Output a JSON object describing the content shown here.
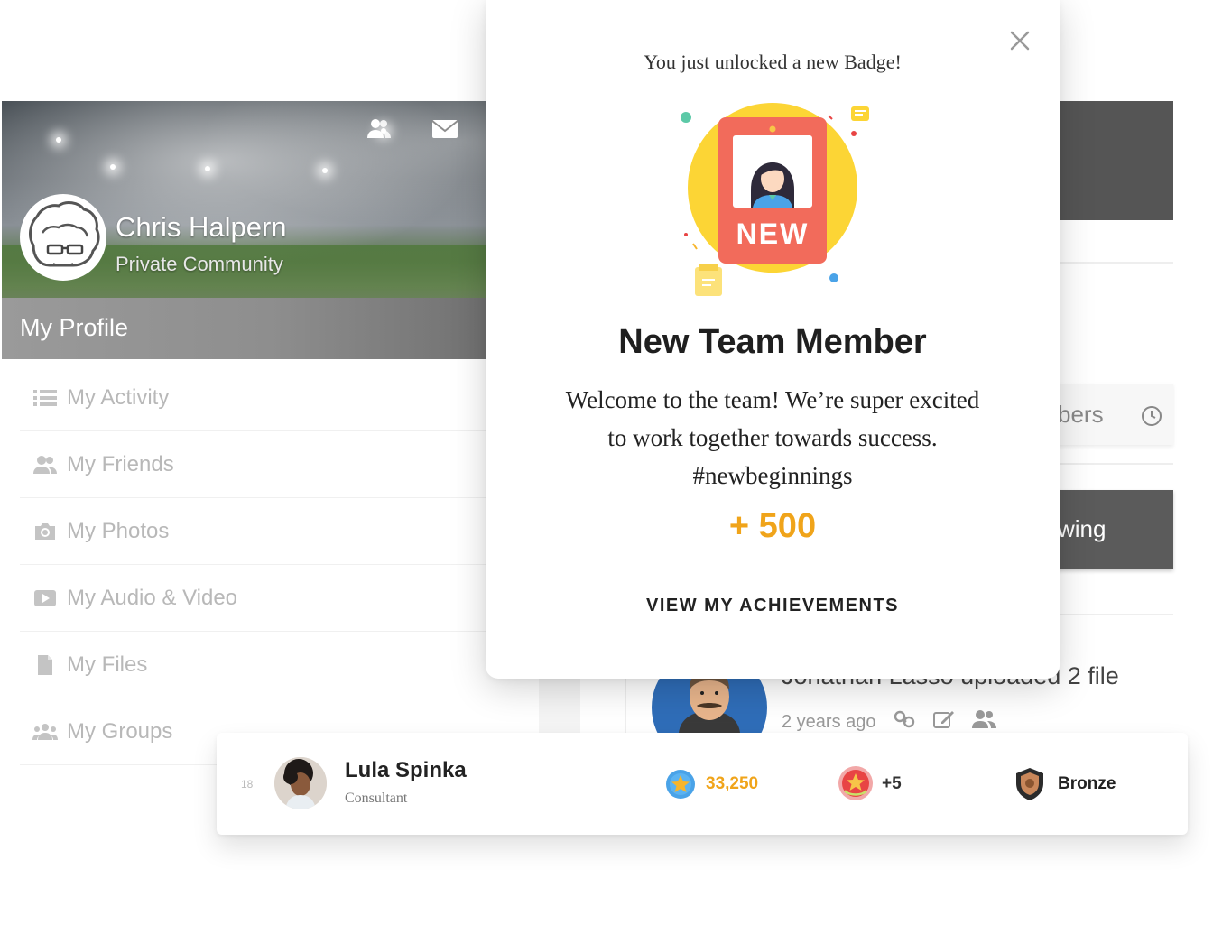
{
  "profile": {
    "name": "Chris Halpern",
    "community": "Private Community",
    "section_title": "My Profile",
    "header_icons": [
      "friends-icon",
      "mail-icon"
    ],
    "menu": [
      {
        "label": "My Activity",
        "icon": "list-icon"
      },
      {
        "label": "My Friends",
        "icon": "friends-icon"
      },
      {
        "label": "My Photos",
        "icon": "camera-icon"
      },
      {
        "label": "My Audio & Video",
        "icon": "video-icon"
      },
      {
        "label": "My Files",
        "icon": "file-icon"
      },
      {
        "label": "My Groups",
        "icon": "groups-icon"
      }
    ]
  },
  "feed": {
    "members_tab": "bers",
    "following_button": "wing",
    "activity": {
      "text": "Jonathan Lasso uploaded 2 file",
      "time": "2 years ago"
    }
  },
  "leaderboard_row": {
    "rank": "18",
    "name": "Lula Spinka",
    "role": "Consultant",
    "points": "33,250",
    "awards": "+5",
    "rank_label": "Bronze"
  },
  "modal": {
    "intro": "You just unlocked a new Badge!",
    "badge_text": "NEW",
    "title": "New Team Member",
    "description": "Welcome to the team! We’re super excited to work together towards success. #newbeginnings",
    "points": "+ 500",
    "link": "VIEW MY ACHIEVEMENTS"
  },
  "colors": {
    "accent_orange": "#f0a41a",
    "dark_gray": "#555555",
    "badge_red": "#f26b5b",
    "badge_yellow": "#fcd535"
  }
}
